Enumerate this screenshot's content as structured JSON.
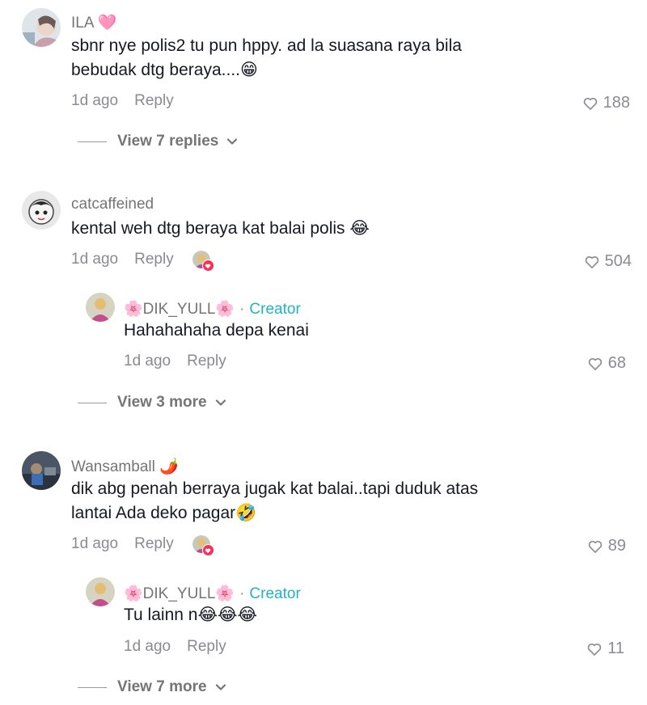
{
  "comments": [
    {
      "username": "ILA",
      "username_emoji": "🩷",
      "text_lines": [
        "sbnr nye polis2 tu pun hppy. ad la suasana raya bila",
        "bebudak dtg beraya....😁"
      ],
      "time": "1d ago",
      "reply_label": "Reply",
      "likes": "188",
      "view_replies": "View 7 replies"
    },
    {
      "username": "catcaffeined",
      "text_lines": [
        "kental weh dtg beraya kat balai polis 😂"
      ],
      "time": "1d ago",
      "reply_label": "Reply",
      "likes": "504",
      "reply": {
        "username": "🌸DIK_YULL🌸",
        "dot": "·",
        "creator_label": "Creator",
        "text": "Hahahahaha depa kenai",
        "time": "1d ago",
        "reply_label": "Reply",
        "likes": "68"
      },
      "view_more": "View 3 more"
    },
    {
      "username": "Wansamball",
      "username_emoji": "🌶️",
      "text_lines": [
        "dik abg penah berraya jugak kat balai..tapi duduk atas",
        "lantai Ada deko pagar🤣"
      ],
      "time": "1d ago",
      "reply_label": "Reply",
      "likes": "89",
      "reply": {
        "username": "🌸DIK_YULL🌸",
        "dot": "·",
        "creator_label": "Creator",
        "text": "Tu lainn n😂😂😂",
        "time": "1d ago",
        "reply_label": "Reply",
        "likes": "11"
      },
      "view_more": "View 7 more"
    }
  ],
  "colors": {
    "text": "#161823",
    "muted": "#8a8b91",
    "creator": "#20b2c8",
    "liked_badge": "#fe2c55"
  },
  "icons": [
    "heart-outline-icon",
    "chevron-down-icon",
    "heart-badge-icon"
  ]
}
